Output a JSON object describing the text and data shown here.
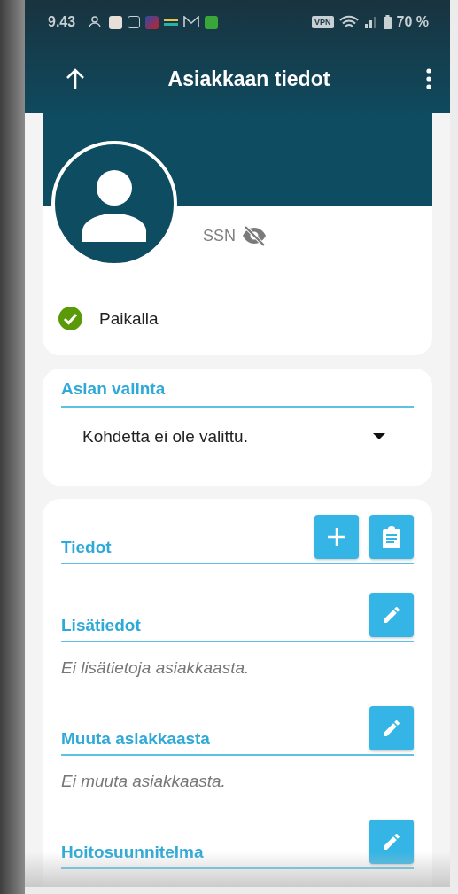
{
  "status_bar": {
    "time": "9.43",
    "vpn": "VPN",
    "battery": "70 %"
  },
  "app_bar": {
    "title": "Asiakkaan tiedot"
  },
  "profile": {
    "ssn_label": "SSN",
    "ssn_hidden": true,
    "status": "Paikalla",
    "present": true
  },
  "case_select": {
    "label": "Asian valinta",
    "value": "Kohdetta ei ole valittu."
  },
  "sections": [
    {
      "title": "Tiedot",
      "actions": [
        {
          "kind": "add"
        },
        {
          "kind": "notes"
        }
      ]
    },
    {
      "title": "Lisätiedot",
      "actions": [
        {
          "kind": "edit"
        }
      ],
      "empty_text": "Ei lisätietoja asiakkaasta."
    },
    {
      "title": "Muuta asiakkaasta",
      "actions": [
        {
          "kind": "edit"
        }
      ],
      "empty_text": "Ei muuta asiakkaasta."
    },
    {
      "title": "Hoitosuunnitelma",
      "actions": [
        {
          "kind": "edit"
        }
      ]
    }
  ]
}
